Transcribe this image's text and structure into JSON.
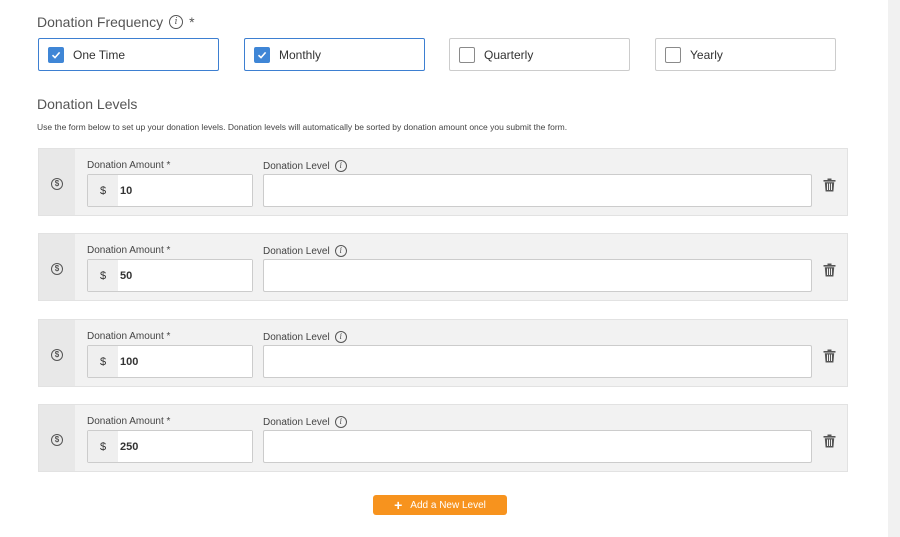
{
  "frequency": {
    "title": "Donation Frequency",
    "required_mark": "*",
    "options": [
      {
        "label": "One Time",
        "checked": true
      },
      {
        "label": "Monthly",
        "checked": true
      },
      {
        "label": "Quarterly",
        "checked": false
      },
      {
        "label": "Yearly",
        "checked": false
      }
    ]
  },
  "levels": {
    "title": "Donation Levels",
    "help": "Use the form below to set up your donation levels. Donation levels will automatically be sorted by donation amount once you submit the form.",
    "amount_label": "Donation Amount *",
    "level_label": "Donation Level",
    "currency": "$",
    "items": [
      {
        "amount": "10",
        "level": ""
      },
      {
        "amount": "50",
        "level": ""
      },
      {
        "amount": "100",
        "level": ""
      },
      {
        "amount": "250",
        "level": ""
      }
    ]
  },
  "add_button": {
    "icon": "+",
    "label": "Add a New Level"
  },
  "colors": {
    "accent": "#3f86d6",
    "add_button": "#f7931e"
  },
  "icons": {
    "info": "info-icon",
    "dollar": "dollar-circle-icon",
    "trash": "trash-icon",
    "check": "check-icon"
  }
}
